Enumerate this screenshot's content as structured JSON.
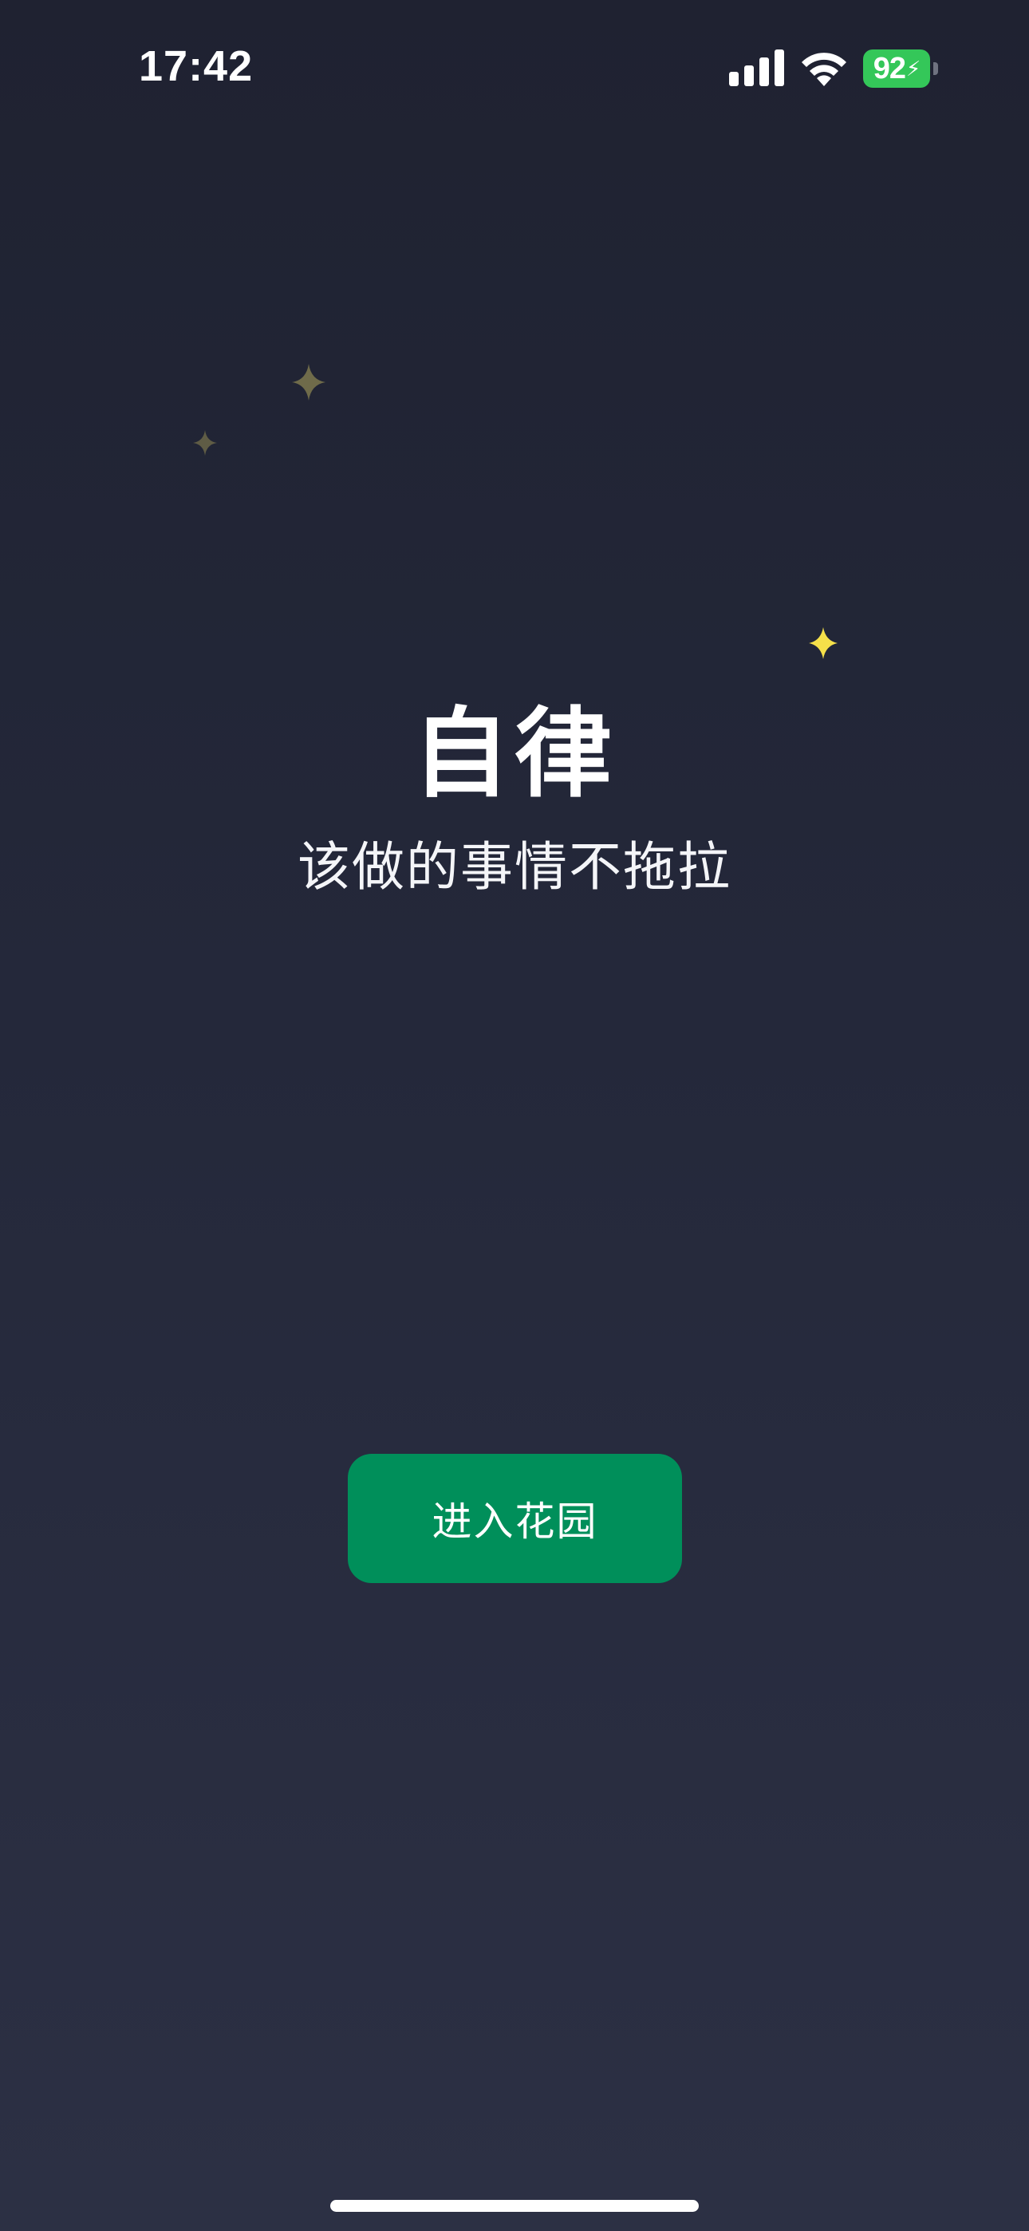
{
  "status_bar": {
    "time": "17:42",
    "battery_level": "92",
    "battery_color": "#34c759",
    "icons": [
      "signal-icon",
      "wifi-icon",
      "battery-icon",
      "charging-bolt-icon"
    ]
  },
  "hero": {
    "title": "自律",
    "subtitle": "该做的事情不拖拉"
  },
  "actions": {
    "enter_label": "进入花园",
    "enter_color": "#008f5a"
  },
  "decorations": {
    "sparkle_icons": [
      "sparkle-icon",
      "sparkle-icon",
      "sparkle-icon"
    ],
    "sparkle_dim_color": "#6f6b4a",
    "sparkle_bright_color": "#f5e04a"
  },
  "theme": {
    "background_top": "#1f2231",
    "background_bottom": "#2c3044"
  }
}
